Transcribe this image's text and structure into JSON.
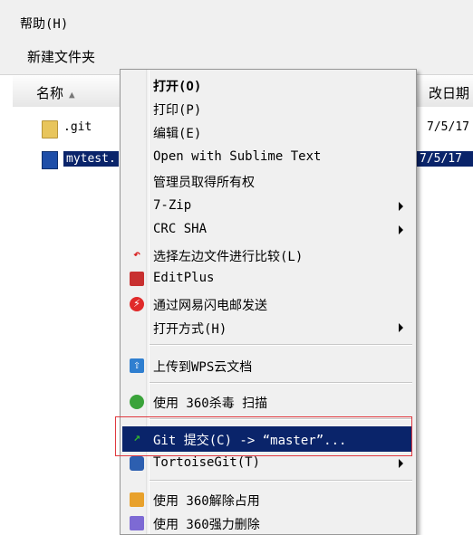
{
  "menubar": {
    "help": "帮助(H)"
  },
  "toolbar": {
    "new_folder": "新建文件夹"
  },
  "columns": {
    "name": "名称",
    "date": "改日期"
  },
  "files": [
    {
      "name": ".git",
      "date": "7/5/17"
    },
    {
      "name": "mytest.",
      "date": "7/5/17"
    }
  ],
  "context_menu": {
    "items": [
      {
        "label": "打开(O)"
      },
      {
        "label": "打印(P)"
      },
      {
        "label": "编辑(E)"
      },
      {
        "label": "Open with Sublime Text"
      },
      {
        "label": "管理员取得所有权"
      },
      {
        "label": "7-Zip"
      },
      {
        "label": "CRC SHA"
      },
      {
        "label": "选择左边文件进行比较(L)"
      },
      {
        "label": "EditPlus"
      },
      {
        "label": "通过网易闪电邮发送"
      },
      {
        "label": "打开方式(H)"
      },
      {
        "label": "上传到WPS云文档"
      },
      {
        "label": "使用 360杀毒 扫描"
      },
      {
        "label": "Git 提交(C) -> “master”..."
      },
      {
        "label": "TortoiseGit(T)"
      },
      {
        "label": "使用 360解除占用"
      },
      {
        "label": "使用 360强力删除"
      }
    ]
  },
  "colors": {
    "selection": "#0a246a",
    "annotation_box": "#e0383e"
  }
}
